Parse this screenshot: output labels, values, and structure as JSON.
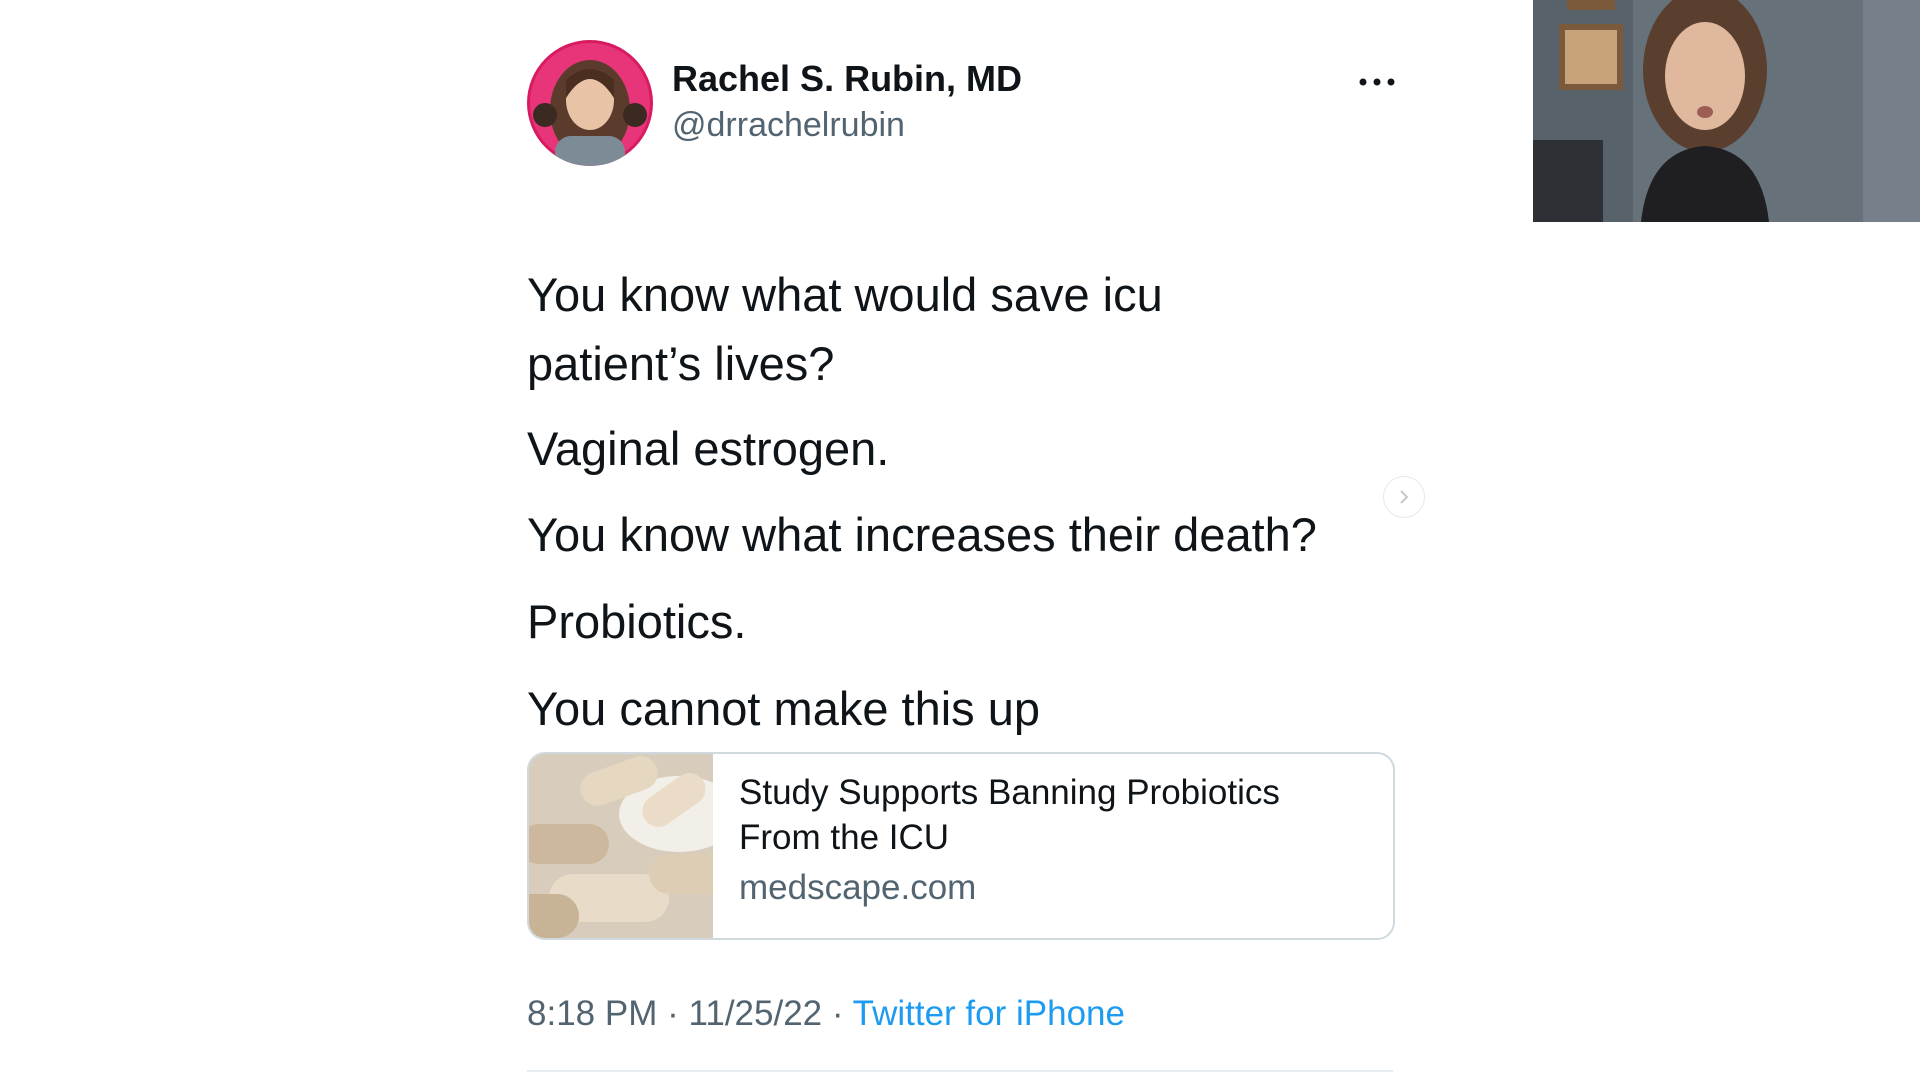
{
  "tweet": {
    "author": {
      "name": "Rachel S. Rubin, MD",
      "handle": "@drrachelrubin"
    },
    "more_icon": "more-horizontal-icon",
    "lines": [
      "You know what would save icu",
      "patient’s lives?",
      "Vaginal estrogen.",
      "You know what increases their death?",
      "Probiotics.",
      "You cannot make this up"
    ],
    "link_card": {
      "title": "Study Supports Banning Probiotics From the ICU",
      "domain": "medscape.com"
    },
    "meta": {
      "time": "8:18 PM",
      "date": "11/25/22",
      "separator": "·",
      "source": "Twitter for iPhone"
    }
  },
  "navigation": {
    "next_icon": "chevron-right-icon"
  },
  "colors": {
    "text_primary": "#0f1419",
    "text_secondary": "#536471",
    "link_blue": "#1d9bf0",
    "card_border": "#cfd9de",
    "avatar_ring": "#d81b60"
  }
}
